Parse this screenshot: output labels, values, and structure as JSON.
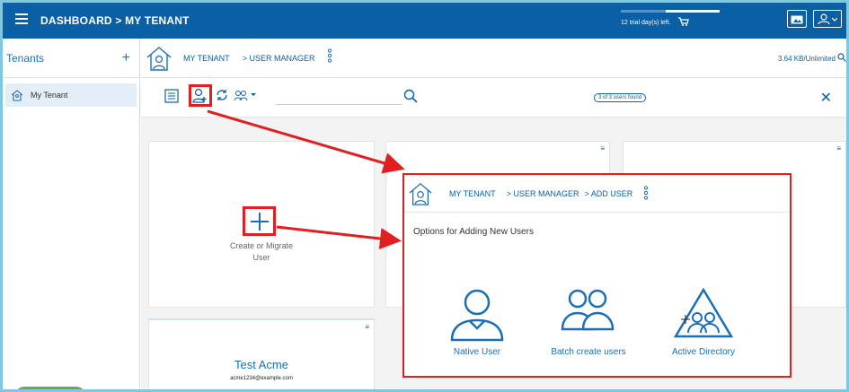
{
  "topbar": {
    "title": "DASHBOARD > MY TENANT",
    "trial_text": "12 trial day(s) left.",
    "trial_progress": 0.55
  },
  "sidebar": {
    "heading": "Tenants",
    "add_symbol": "+",
    "items": [
      {
        "label": "My Tenant"
      }
    ]
  },
  "breadcrumb": {
    "tenant": "MY TENANT",
    "page": "> USER MANAGER",
    "storage": "3.64 KB/Unlimited"
  },
  "toolbar": {
    "search_placeholder": "",
    "found_text": "3 of 3 users found",
    "close_symbol": "✕"
  },
  "cards": {
    "create_label_line1": "Create or Migrate",
    "create_label_line2": "User",
    "acme_name": "Test Acme",
    "acme_email": "acme1234@example.com"
  },
  "popup": {
    "tenant": "MY TENANT",
    "crumb1": "> USER MANAGER",
    "crumb2": "> ADD USER",
    "title": "Options for Adding New Users",
    "options": [
      {
        "label": "Native User",
        "icon": "native-user-icon"
      },
      {
        "label": "Batch create users",
        "icon": "batch-users-icon"
      },
      {
        "label": "Active Directory",
        "icon": "active-directory-icon"
      }
    ]
  },
  "colors": {
    "primary": "#0b5fa5",
    "highlight": "#e02020",
    "accent": "#1b6fb8"
  }
}
